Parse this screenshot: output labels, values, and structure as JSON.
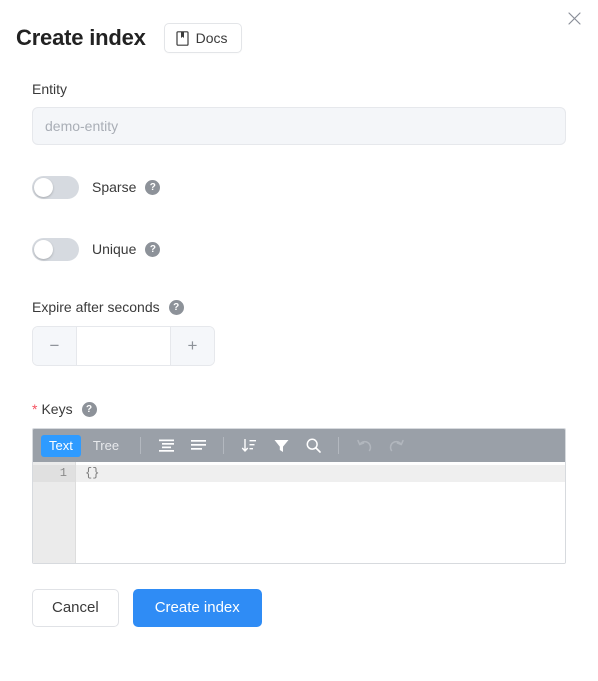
{
  "header": {
    "title": "Create index",
    "docs_label": "Docs",
    "docs_icon": "book-icon",
    "close_icon": "close-icon"
  },
  "form": {
    "entity": {
      "label": "Entity",
      "value": "",
      "placeholder": "demo-entity"
    },
    "sparse": {
      "label": "Sparse",
      "state": "off",
      "help_icon": "question-mark-icon"
    },
    "unique": {
      "label": "Unique",
      "state": "off",
      "help_icon": "question-mark-icon"
    },
    "expire": {
      "label": "Expire after seconds",
      "help_icon": "question-mark-icon",
      "value": "",
      "placeholder": "",
      "decrement_label": "−",
      "increment_label": "+"
    },
    "keys": {
      "required_marker": "*",
      "label": "Keys",
      "help_icon": "question-mark-icon"
    }
  },
  "editor": {
    "tabs": [
      {
        "label": "Text",
        "active": true
      },
      {
        "label": "Tree",
        "active": false
      }
    ],
    "tools": [
      {
        "name": "format-icon",
        "title": "Format JSON",
        "disabled": false
      },
      {
        "name": "compact-icon",
        "title": "Compact JSON",
        "disabled": false
      },
      {
        "name": "sort-icon",
        "title": "Sort",
        "disabled": false
      },
      {
        "name": "filter-icon",
        "title": "Filter",
        "disabled": false
      },
      {
        "name": "search-icon",
        "title": "Search",
        "disabled": false
      },
      {
        "name": "undo-icon",
        "title": "Undo",
        "disabled": true
      },
      {
        "name": "redo-icon",
        "title": "Redo",
        "disabled": true
      }
    ],
    "line_number": "1",
    "content": "{}"
  },
  "footer": {
    "cancel_label": "Cancel",
    "submit_label": "Create index"
  },
  "colors": {
    "accent": "#2f8cf5",
    "tab_active": "#2f9bff",
    "toolbar_bg": "#9aa0a8",
    "required": "#f5515f",
    "toggle_off": "#d6dae0"
  }
}
